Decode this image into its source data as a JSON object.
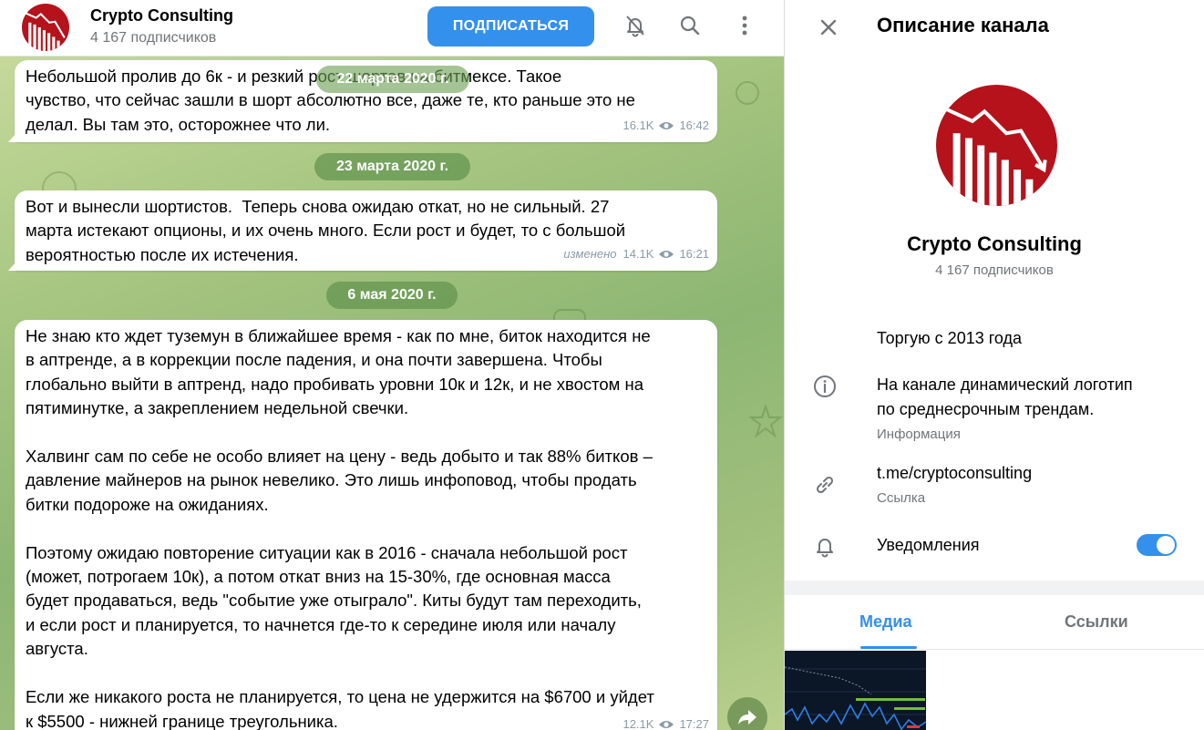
{
  "colors": {
    "accent": "#3390ec",
    "logo_red": "#b5121b",
    "chat_bg": "#a4c47f"
  },
  "header": {
    "channel_name": "Crypto Consulting",
    "subscribers": "4 167 подписчиков",
    "subscribe_label": "ПОДПИСАТЬСЯ",
    "icons": [
      "bell-off-icon",
      "search-icon",
      "more-vertical-icon"
    ]
  },
  "chat": {
    "floating_date": "22 марта 2020 г.",
    "messages": [
      {
        "text": "Небольшой пролив до 6к - и резкий рост шортов на битмексе. Такое\nчувство, что сейчас зашли в шорт абсолютно все, даже те, кто раньше это не\nделал. Вы там это, осторожнее что ли.",
        "views": "16.1K",
        "time": "16:42"
      },
      {
        "date": "23 марта 2020 г.",
        "text": "Вот и вынесли шортистов.  Теперь снова ожидаю откат, но не сильный. 27\nмарта истекают опционы, и их очень много. Если рост и будет, то с большой\nвероятностью после их истечения.",
        "edited": "изменено",
        "views": "14.1K",
        "time": "16:21"
      },
      {
        "date": "6 мая 2020 г.",
        "text": "Не знаю кто ждет туземун в ближайшее время - как по мне, биток находится не\nв аптренде, а в коррекции после падения, и она почти завершена. Чтобы\nглобально выйти в аптренд, надо пробивать уровни 10к и 12к, и не хвостом на\nпятиминутке, а закреплением недельной свечки.\n\nХалвинг сам по себе не особо влияет на цену - ведь добыто и так 88% битков –\nдавление майнеров на рынок невелико. Это лишь инфоповод, чтобы продать\nбитки подороже на ожиданиях.\n\nПоэтому ожидаю повторение ситуации как в 2016 - сначала небольшой рост\n(может, потрогаем 10к), а потом откат вниз на 15-30%, где основная масса\nбудет продаваться, ведь \"событие уже отыграло\". Киты будут там переходить,\nи если рост и планируется, то начнется где-то к середине июля или началу\nавгуста.\n\nЕсли же никакого роста не планируется, то цена не удержится на $6700 и уйдет\nк $5500 - нижней границе треугольника.",
        "views": "12.1K",
        "time": "17:27"
      }
    ]
  },
  "info": {
    "title": "Описание канала",
    "name": "Crypto Consulting",
    "subscribers": "4 167 подписчиков",
    "description": "Торгую с 2013 года",
    "about_text": "На канале динамический логотип\nпо среднесрочным трендам.",
    "about_label": "Информация",
    "link_text": "t.me/cryptoconsulting",
    "link_label": "Ссылка",
    "notifications_label": "Уведомления",
    "notifications_on": true,
    "tabs": [
      "Медиа",
      "Ссылки"
    ],
    "active_tab": "Медиа"
  }
}
